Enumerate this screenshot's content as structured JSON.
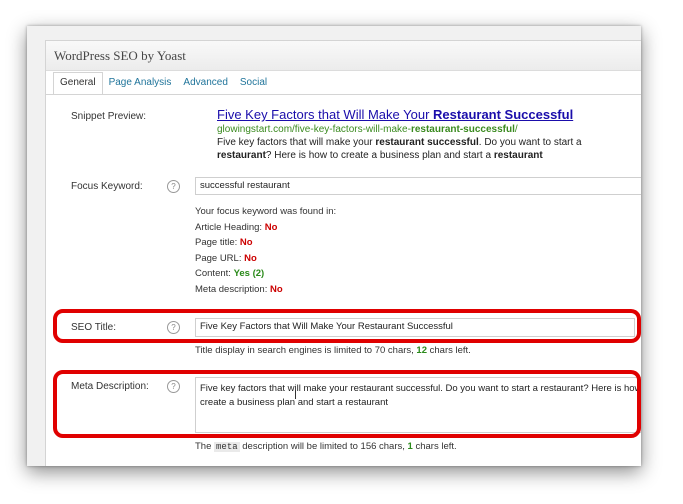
{
  "panel": {
    "title": "WordPress SEO by Yoast"
  },
  "tabs": [
    {
      "label": "General",
      "active": true
    },
    {
      "label": "Page Analysis",
      "active": false
    },
    {
      "label": "Advanced",
      "active": false
    },
    {
      "label": "Social",
      "active": false
    }
  ],
  "snippet": {
    "label": "Snippet Preview:",
    "title_pre": "Five Key Factors that Will Make Your ",
    "title_bold": "Restaurant Successful",
    "url_pre": "glowingstart.com/five-key-factors-will-make-",
    "url_bold": "restaurant-successful",
    "url_post": "/",
    "desc_1": "Five key factors that will make your ",
    "desc_bold1": "restaurant successful",
    "desc_2": ". Do you want to start a",
    "desc_bold2": "restaurant",
    "desc_3": "? Here is how to create a business plan and start a ",
    "desc_bold3": "restaurant"
  },
  "focus": {
    "label": "Focus Keyword:",
    "value": "successful restaurant",
    "found_title": "Your focus keyword was found in:",
    "checks": [
      {
        "label": "Article Heading: ",
        "result": "No",
        "ok": false
      },
      {
        "label": "Page title: ",
        "result": "No",
        "ok": false
      },
      {
        "label": "Page URL: ",
        "result": "No",
        "ok": false
      },
      {
        "label": "Content: ",
        "result": "Yes (2)",
        "ok": true
      },
      {
        "label": "Meta description: ",
        "result": "No",
        "ok": false
      }
    ]
  },
  "seo_title": {
    "label": "SEO Title:",
    "value": "Five Key Factors that Will Make Your Restaurant Successful",
    "hint_pre": "Title display in search engines is limited to 70 chars, ",
    "hint_num": "12",
    "hint_post": " chars left."
  },
  "meta": {
    "label": "Meta Description:",
    "value": "Five key factors that will make your restaurant successful. Do you want to start a restaurant? Here is how to create a business plan and start a restaurant",
    "hint_pre": "The ",
    "hint_code": "meta",
    "hint_mid": " description will be limited to 156 chars, ",
    "hint_num": "1",
    "hint_post": " chars left."
  },
  "icons": {
    "help": "?"
  },
  "colors": {
    "highlight": "#e00000",
    "link": "#1a0dab",
    "url": "#3a8a1f",
    "no": "#cc0000",
    "yes": "#2a8a1a"
  }
}
